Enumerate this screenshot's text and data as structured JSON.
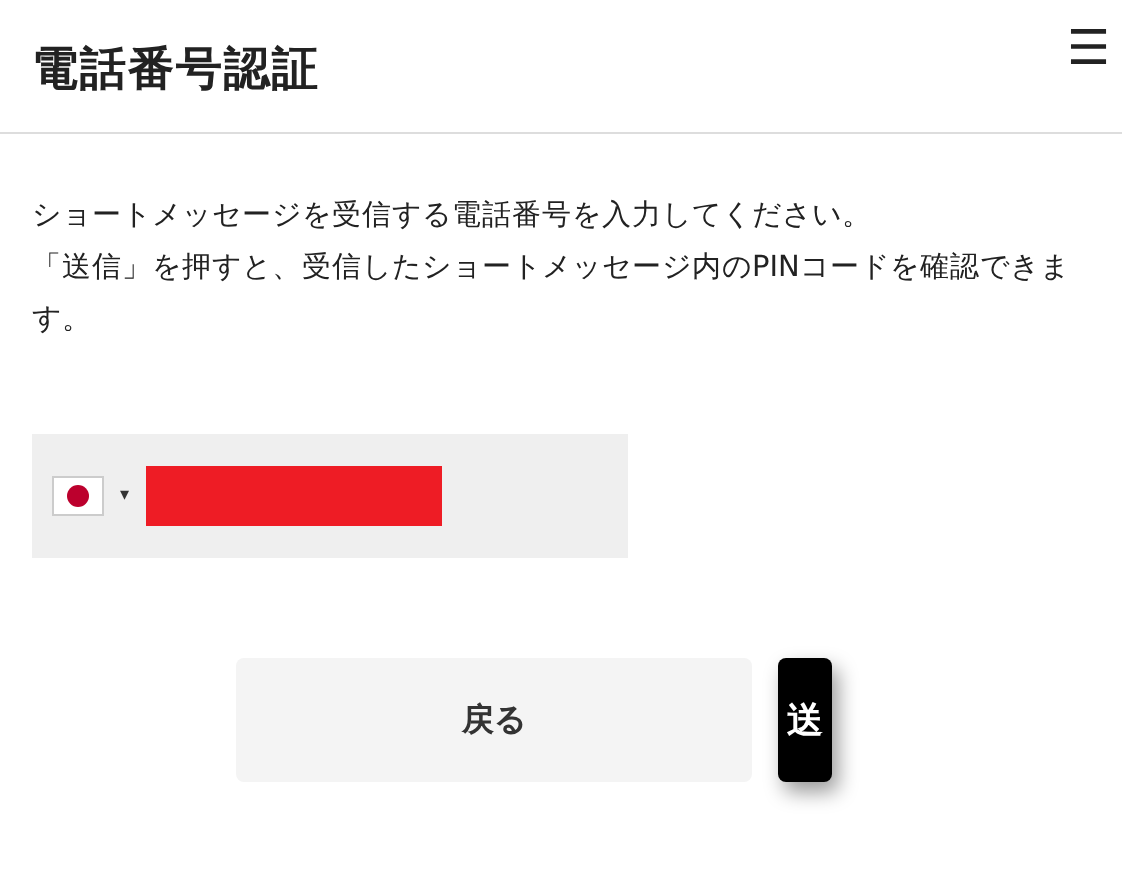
{
  "header": {
    "title": "電話番号認証",
    "menu_icon": "☰"
  },
  "instructions": [
    "ショートメッセージを受信する電話番号を入力してください。",
    "「送信」を押すと、受信したショートメッセージ内のPINコードを確認できます。"
  ],
  "phone_field": {
    "country_caret": "▾",
    "value_redacted": true
  },
  "buttons": [
    {
      "label": "戻る",
      "kind": "secondary"
    },
    {
      "label": "送",
      "kind": "primary"
    }
  ]
}
